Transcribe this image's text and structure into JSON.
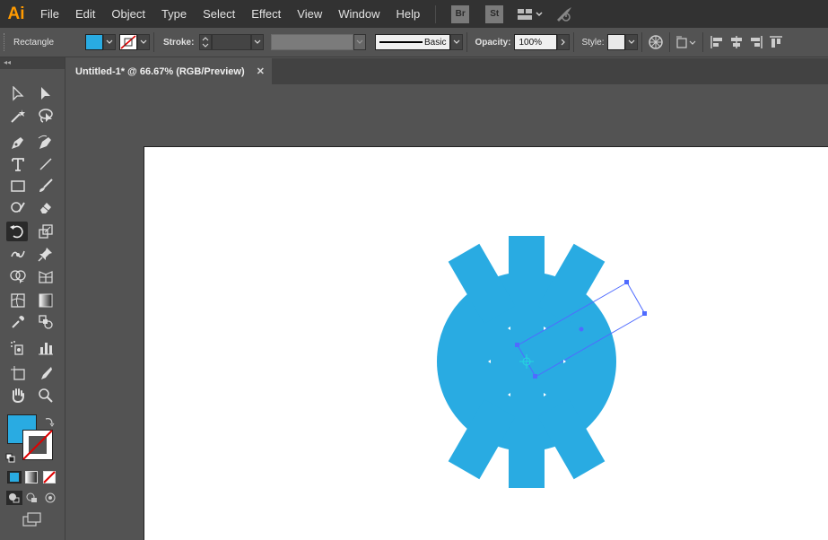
{
  "app": {
    "logo": "Ai",
    "accent_color": "#ff9a00"
  },
  "menu": {
    "items": [
      "File",
      "Edit",
      "Object",
      "Type",
      "Select",
      "Effect",
      "View",
      "Window",
      "Help"
    ],
    "bridge_label": "Br",
    "stock_label": "St"
  },
  "control": {
    "object_type": "Rectangle",
    "fill_color": "#29abe2",
    "stroke_label": "Stroke:",
    "brush_label": "Basic",
    "opacity_label": "Opacity:",
    "opacity_value": "100%",
    "style_label": "Style:"
  },
  "tab": {
    "title": "Untitled-1* @ 66.67% (RGB/Preview)",
    "close_glyph": "✕"
  },
  "toolbar": {
    "header_glyph": "◂◂",
    "active_tool": "rotate-tool",
    "fill_color": "#29abe2",
    "stroke_color": "none"
  },
  "artwork": {
    "shape_color": "#29abe2",
    "selection_color": "#4f6bff"
  }
}
